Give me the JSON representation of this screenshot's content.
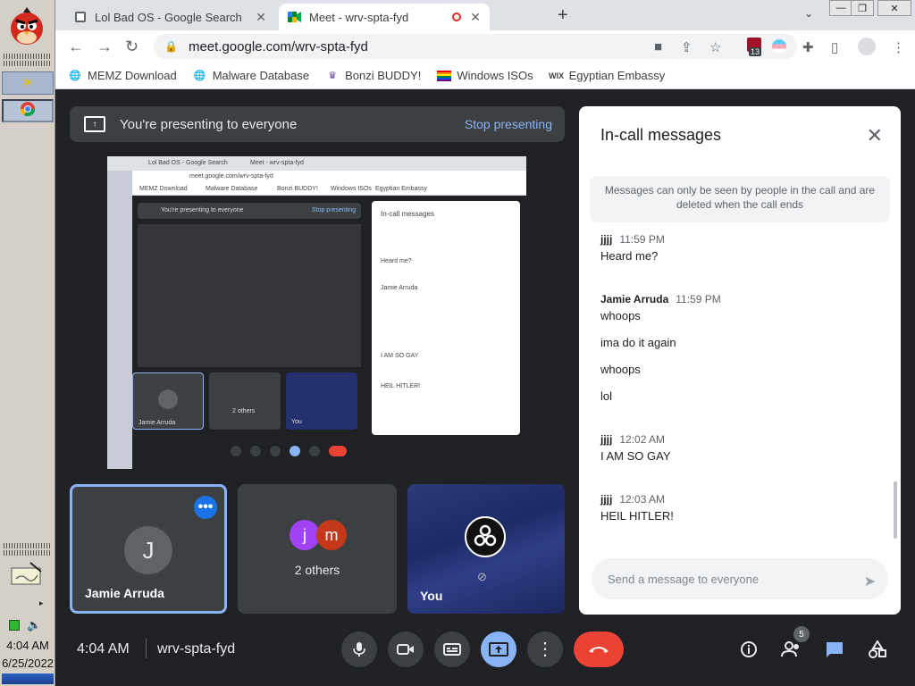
{
  "taskbar": {
    "time": "4:04 AM",
    "date": "6/25/2022",
    "tray_arrow": "▸"
  },
  "browser": {
    "tabs": [
      {
        "title": "Lol Bad OS - Google Search",
        "icon": "grid-icon"
      },
      {
        "title": "Meet - wrv-spta-fyd",
        "icon": "meet-icon"
      }
    ],
    "url": "meet.google.com/wrv-spta-fyd",
    "extension_badge": "13",
    "bookmarks": [
      {
        "label": "MEMZ Download",
        "icon": "globe-icon"
      },
      {
        "label": "Malware Database",
        "icon": "globe-icon"
      },
      {
        "label": "Bonzi BUDDY!",
        "icon": "bonzi-icon"
      },
      {
        "label": "Windows ISOs",
        "icon": "rainbow-flag-icon"
      },
      {
        "label": "Egyptian Embassy",
        "icon": "wix-icon"
      }
    ]
  },
  "meet": {
    "banner_text": "You're presenting to everyone",
    "stop_presenting": "Stop presenting",
    "time": "4:04 AM",
    "meeting_code": "wrv-spta-fyd",
    "participant_badge": "5",
    "tiles": [
      {
        "name": "Jamie Arruda",
        "initial": "J"
      },
      {
        "label": "2 others",
        "initials": [
          "j",
          "m"
        ]
      },
      {
        "name": "You"
      }
    ]
  },
  "chat": {
    "title": "In-call messages",
    "note": "Messages can only be seen by people in the call and are deleted when the call ends",
    "messages": [
      {
        "sender": "jjjj",
        "time": "11:59 PM",
        "lines": [
          "Heard me?"
        ]
      },
      {
        "sender": "Jamie Arruda",
        "time": "11:59 PM",
        "lines": [
          "whoops",
          "ima do it again",
          "whoops",
          "lol"
        ]
      },
      {
        "sender": "jjjj",
        "time": "12:02 AM",
        "lines": [
          "I AM SO GAY"
        ]
      },
      {
        "sender": "jjjj",
        "time": "12:03 AM",
        "lines": [
          "HEIL HITLER!"
        ]
      }
    ],
    "input_placeholder": "Send a message to everyone"
  },
  "colors": {
    "accent_blue": "#8ab4f8",
    "end_call_red": "#ea4335",
    "meet_bg": "#202124"
  }
}
